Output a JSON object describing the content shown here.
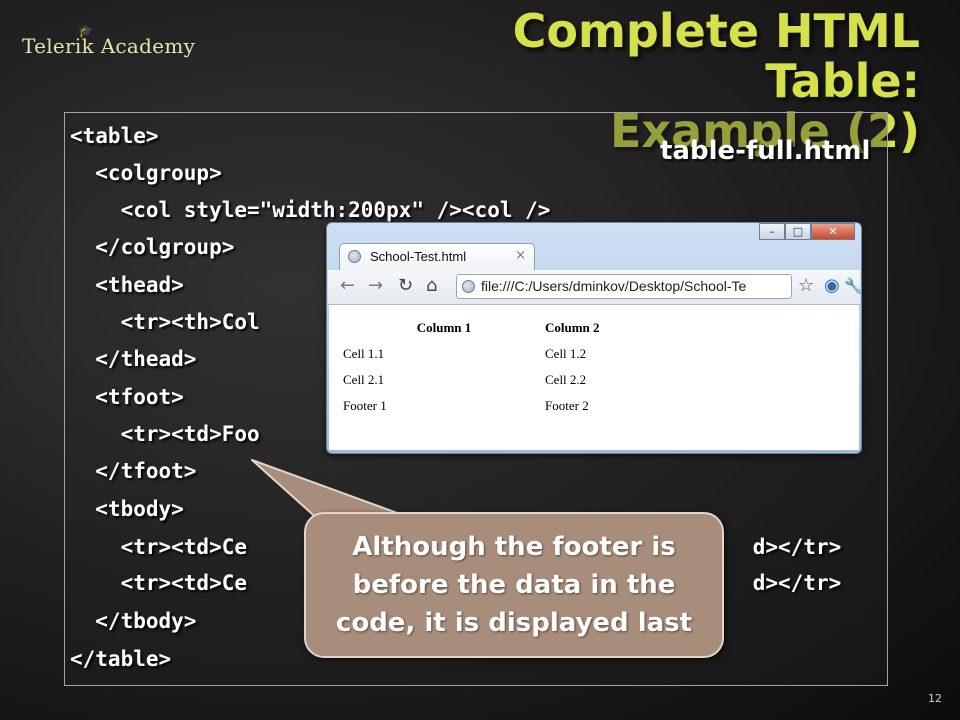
{
  "brand": {
    "name": "Telerik Academy"
  },
  "slide": {
    "title_line1": "Complete HTML Table:",
    "title_line2": "Example (2)",
    "filename": "table-full.html",
    "page_number": "12"
  },
  "code_lines": [
    "<table>",
    "  <colgroup>",
    "    <col style=\"width:200px\" /><col />",
    "  </colgroup>",
    "  <thead>",
    "    <tr><th>Col",
    "  </thead>",
    "  <tfoot>",
    "    <tr><td>Foo",
    "  </tfoot>",
    "  <tbody>",
    "    <tr><td>Ce                                        d></tr>",
    "    <tr><td>Ce                                        d></tr>",
    "  </tbody>",
    "</table>"
  ],
  "browser": {
    "tab_title": "School-Test.html",
    "tab_close": "×",
    "url": "file:///C:/Users/dminkov/Desktop/School-Te",
    "window_buttons": {
      "minimize": "–",
      "maximize": "□",
      "close": "✕"
    },
    "icons": [
      "back-icon",
      "forward-icon",
      "reload-icon",
      "home-icon",
      "star-icon",
      "extension-icon",
      "wrench-icon"
    ],
    "page_table": {
      "headers": [
        "Column 1",
        "Column 2"
      ],
      "rows": [
        [
          "Cell 1.1",
          "Cell 1.2"
        ],
        [
          "Cell 2.1",
          "Cell 2.2"
        ]
      ],
      "footer": [
        "Footer 1",
        "Footer 2"
      ]
    }
  },
  "callout": {
    "line1": "Although the footer is",
    "line2": "before the data in the",
    "line3": "code, it is displayed last"
  },
  "colors": {
    "title": "#d6e04a",
    "callout_bg": "#a98d7b",
    "logo": "#e8e4b0"
  }
}
